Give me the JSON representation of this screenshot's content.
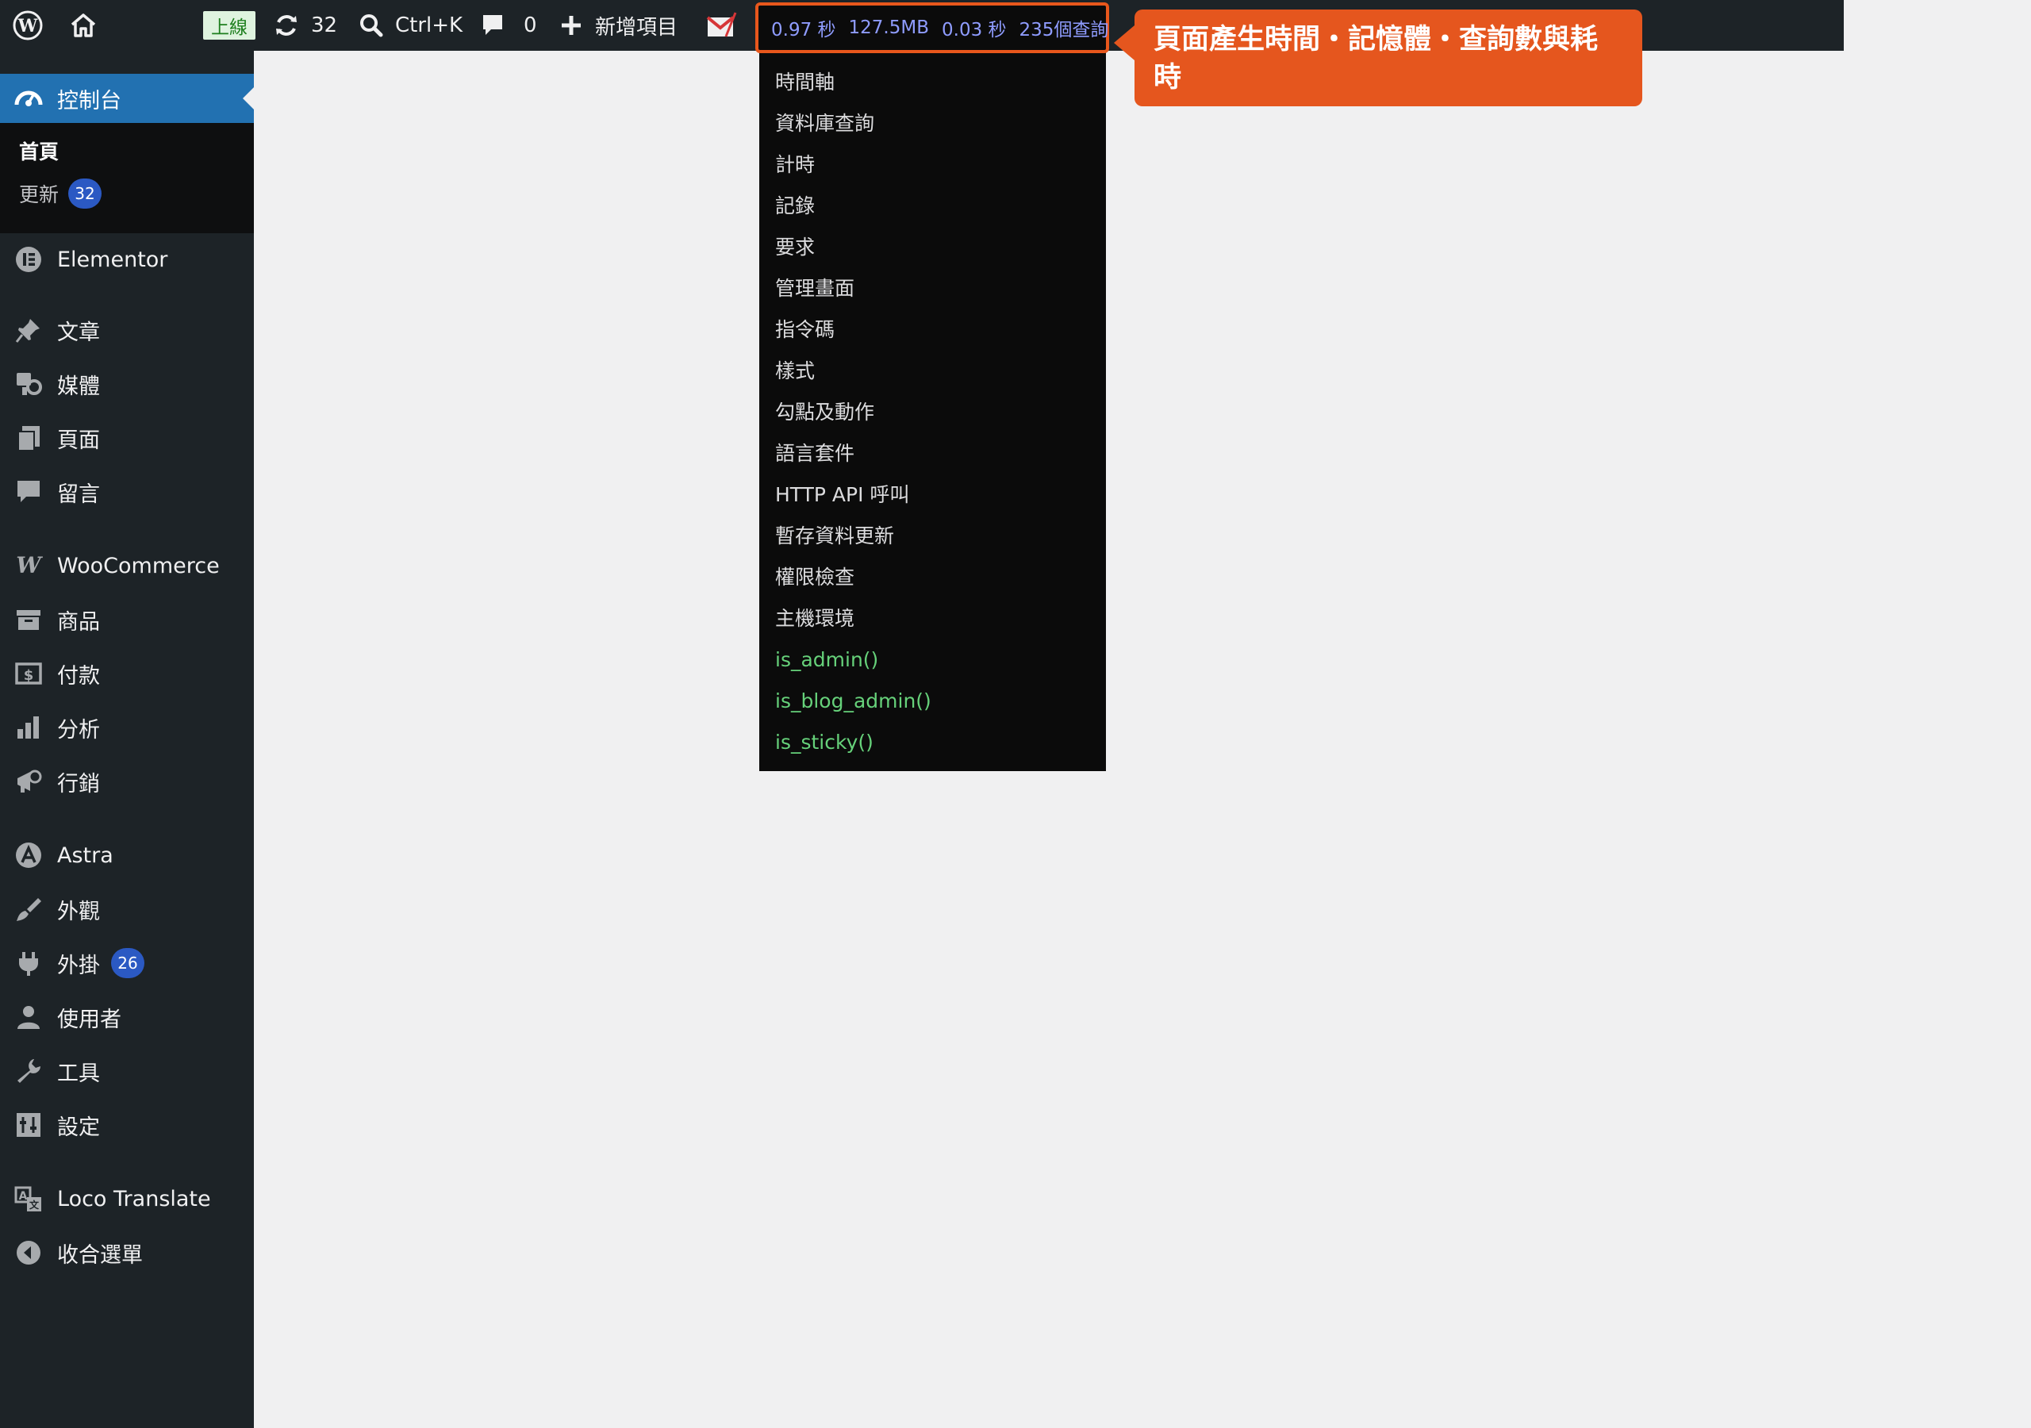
{
  "adminbar": {
    "env_badge": "上線",
    "updates_count": "32",
    "search_shortcut": "Ctrl+K",
    "comments_count": "0",
    "new_label": "新增項目",
    "query_monitor": {
      "time": "0.97 秒",
      "memory": "127.5MB",
      "query_time": "0.03 秒",
      "queries": "235個查詢"
    }
  },
  "callout": {
    "text": "頁面產生時間・記憶體・查詢數與耗時",
    "color": "#e5561e"
  },
  "qm_menu": {
    "items": [
      "時間軸",
      "資料庫查詢",
      "計時",
      "記錄",
      "要求",
      "管理畫面",
      "指令碼",
      "樣式",
      "勾點及動作",
      "語言套件",
      "HTTP API 呼叫",
      "暫存資料更新",
      "權限檢查",
      "主機環境"
    ],
    "conditionals": [
      "is_admin()",
      "is_blog_admin()",
      "is_sticky()"
    ]
  },
  "sidebar": {
    "dashboard": {
      "label": "控制台",
      "icon": "dashboard-icon"
    },
    "submenu": [
      {
        "label": "首頁"
      },
      {
        "label": "更新",
        "badge": "32"
      }
    ],
    "items": [
      {
        "label": "Elementor",
        "icon": "elementor-icon"
      },
      {
        "label": "文章",
        "icon": "pin-icon"
      },
      {
        "label": "媒體",
        "icon": "media-icon"
      },
      {
        "label": "頁面",
        "icon": "pages-icon"
      },
      {
        "label": "留言",
        "icon": "comment-icon"
      },
      {
        "label": "WooCommerce",
        "icon": "woocommerce-icon"
      },
      {
        "label": "商品",
        "icon": "archive-icon"
      },
      {
        "label": "付款",
        "icon": "payment-icon"
      },
      {
        "label": "分析",
        "icon": "chart-icon"
      },
      {
        "label": "行銷",
        "icon": "megaphone-icon"
      },
      {
        "label": "Astra",
        "icon": "astra-icon"
      },
      {
        "label": "外觀",
        "icon": "brush-icon"
      },
      {
        "label": "外掛",
        "icon": "plugin-icon",
        "badge": "26"
      },
      {
        "label": "使用者",
        "icon": "user-icon"
      },
      {
        "label": "工具",
        "icon": "wrench-icon"
      },
      {
        "label": "設定",
        "icon": "settings-icon"
      },
      {
        "label": "Loco Translate",
        "icon": "translate-icon"
      },
      {
        "label": "收合選單",
        "icon": "collapse-icon"
      }
    ]
  },
  "colors": {
    "adminbar_bg": "#1d2327",
    "accent": "#2271b1",
    "badge": "#2b59c3",
    "qm_link": "#8f9cff",
    "conditional_green": "#66d17a"
  }
}
